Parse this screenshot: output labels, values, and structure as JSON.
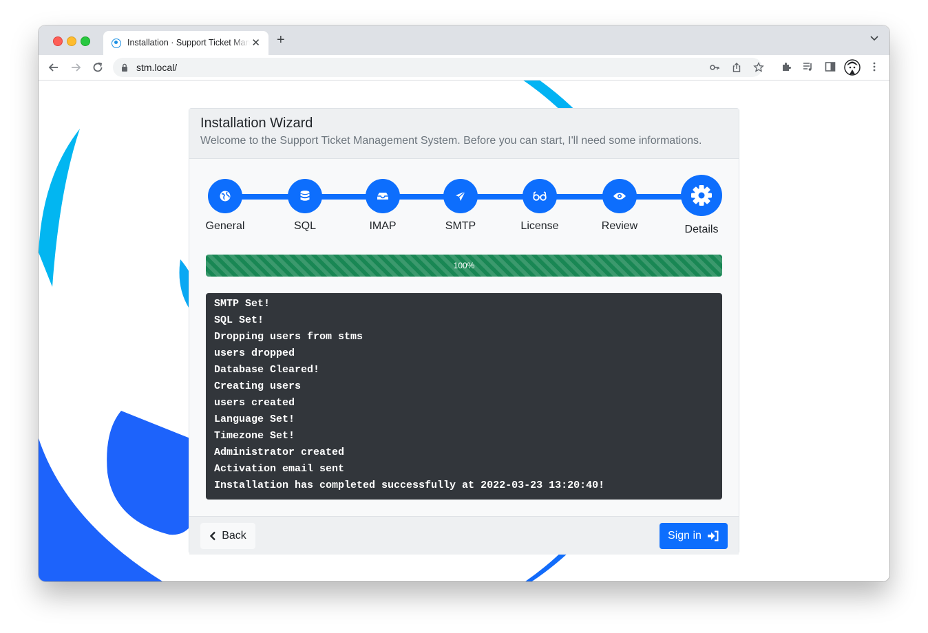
{
  "browser": {
    "tab_title": "Installation · Support Ticket Management System",
    "url": "stm.local/"
  },
  "wizard": {
    "title": "Installation Wizard",
    "subtitle": "Welcome to the Support Ticket Management System. Before you can start, I'll need some informations.",
    "steps": [
      {
        "label": "General",
        "icon": "globe-icon"
      },
      {
        "label": "SQL",
        "icon": "database-icon"
      },
      {
        "label": "IMAP",
        "icon": "inbox-icon"
      },
      {
        "label": "SMTP",
        "icon": "send-icon"
      },
      {
        "label": "License",
        "icon": "glasses-icon"
      },
      {
        "label": "Review",
        "icon": "eye-icon"
      },
      {
        "label": "Details",
        "icon": "gear-icon"
      }
    ],
    "progress": {
      "value_percent": 100,
      "label": "100%"
    },
    "log": [
      "SMTP Set!",
      "SQL Set!",
      "Dropping users from stms",
      "users dropped",
      "Database Cleared!",
      "Creating users",
      "users created",
      "Language Set!",
      "Timezone Set!",
      "Administrator created",
      "Activation email sent",
      "Installation has completed successfully at 2022-03-23 13:20:40!"
    ],
    "back_label": "Back",
    "signin_label": "Sign in"
  },
  "colors": {
    "primary": "#0d6efd",
    "success": "#198754",
    "log_bg": "#32363b",
    "bg_accent": "#00b4f0"
  }
}
